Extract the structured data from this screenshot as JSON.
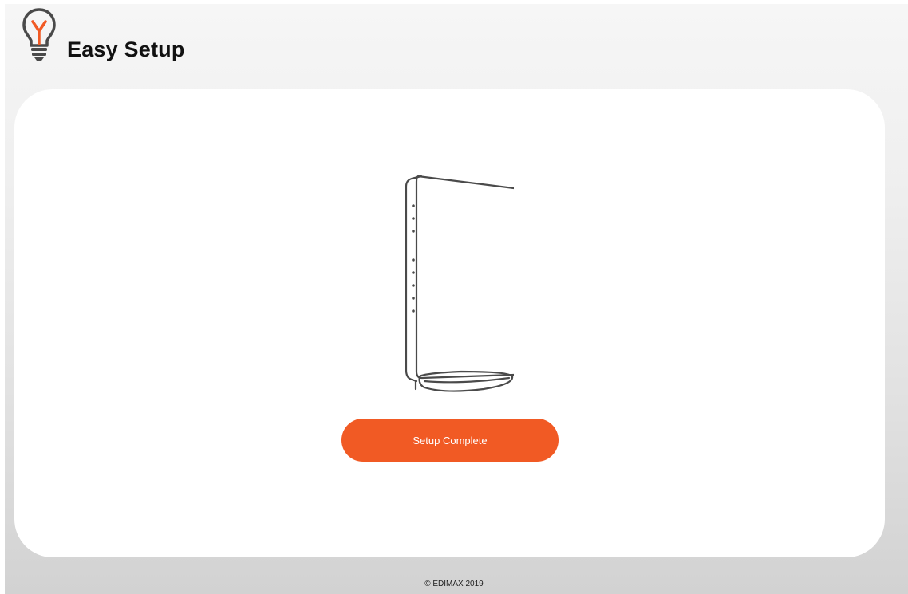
{
  "header": {
    "title": "Easy Setup",
    "icon": "lightbulb-icon"
  },
  "main": {
    "illustration": "router-icon",
    "button_label": "Setup Complete"
  },
  "footer": {
    "copyright": "© EDIMAX 2019"
  },
  "colors": {
    "accent": "#f15a24",
    "icon_stroke": "#4a4a4a",
    "card": "#ffffff"
  }
}
